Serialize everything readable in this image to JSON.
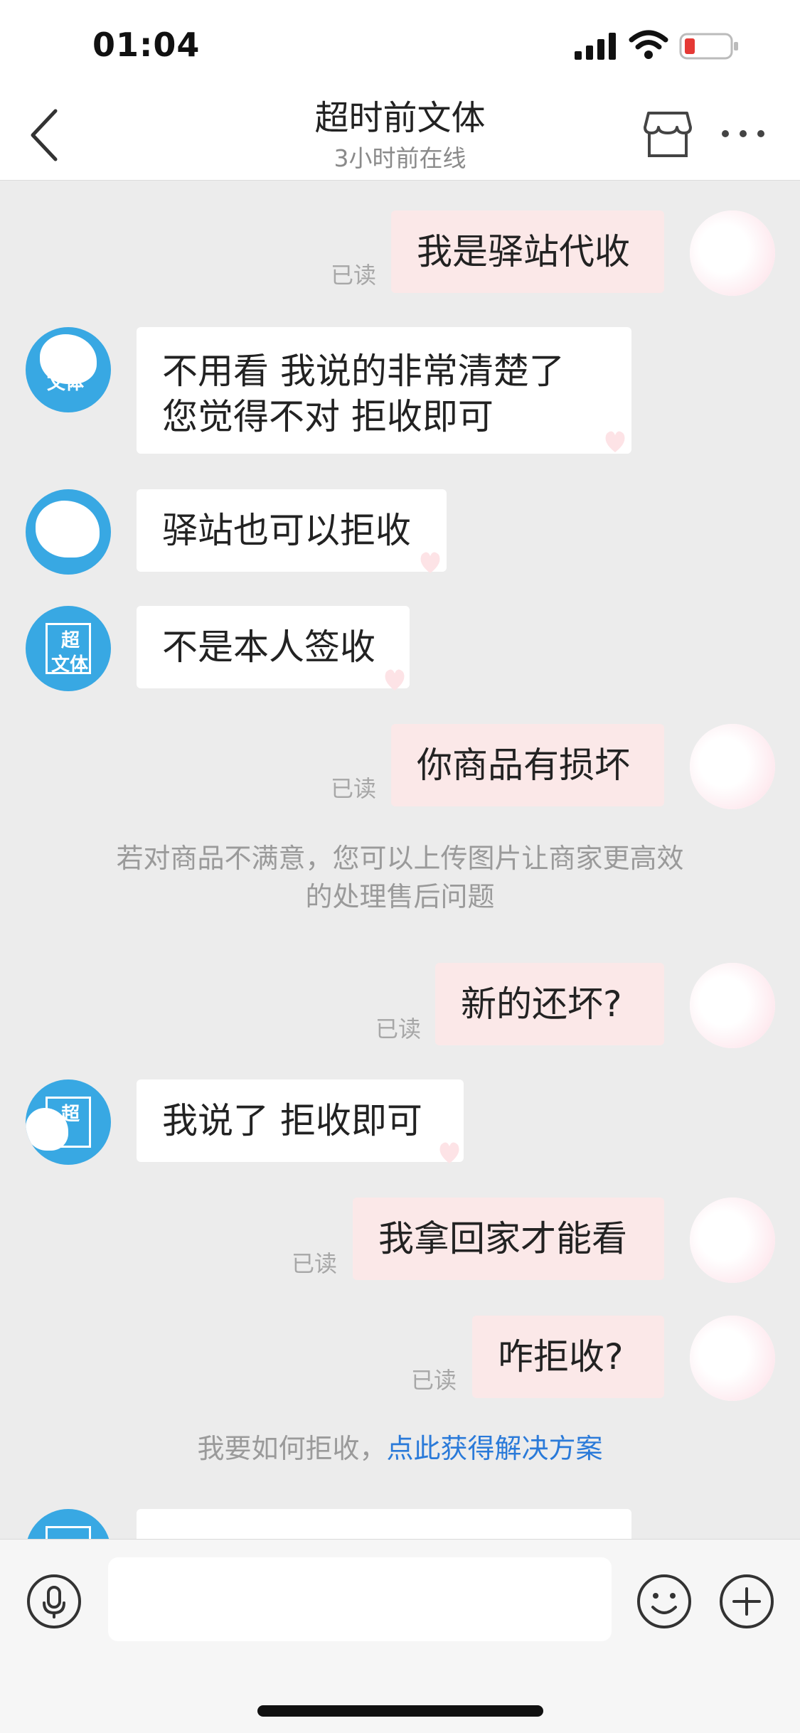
{
  "status_bar": {
    "time": "01:04"
  },
  "header": {
    "title": "超时前文体",
    "subtitle": "3小时前在线"
  },
  "messages": [
    {
      "side": "out",
      "text": "我是驿站代收",
      "read": "已读"
    },
    {
      "side": "in",
      "lines": [
        "不用看  我说的非常清楚了",
        "您觉得不对  拒收即可"
      ]
    },
    {
      "side": "in",
      "text": "驿站也可以拒收"
    },
    {
      "side": "in",
      "text": "不是本人签收"
    },
    {
      "side": "out",
      "text": "你商品有损坏",
      "read": "已读"
    },
    {
      "side": "out",
      "text": "新的还坏?",
      "read": "已读"
    },
    {
      "side": "in",
      "text": "我说了  拒收即可"
    },
    {
      "side": "out",
      "text": "我拿回家才能看",
      "read": "已读"
    },
    {
      "side": "out",
      "text": "咋拒收?",
      "read": "已读"
    }
  ],
  "system_notices": {
    "upload_tip": [
      "若对商品不满意，您可以上传图片让商家更高效",
      "的处理售后问题"
    ],
    "reject_prefix": "我要如何拒收，",
    "reject_link": "点此获得解决方案"
  },
  "avatar_labels": {
    "shop_line1": "超",
    "shop_line2": "文体"
  },
  "input": {
    "placeholder": ""
  },
  "icons": [
    "back-chevron-icon",
    "store-icon",
    "more-dots-icon",
    "mic-icon",
    "emoji-icon",
    "plus-icon"
  ],
  "colors": {
    "outgoing_bubble": "#fbe8e8",
    "incoming_bubble": "#ffffff",
    "avatar_blue": "#38a8e3",
    "link": "#2a7ad9"
  }
}
